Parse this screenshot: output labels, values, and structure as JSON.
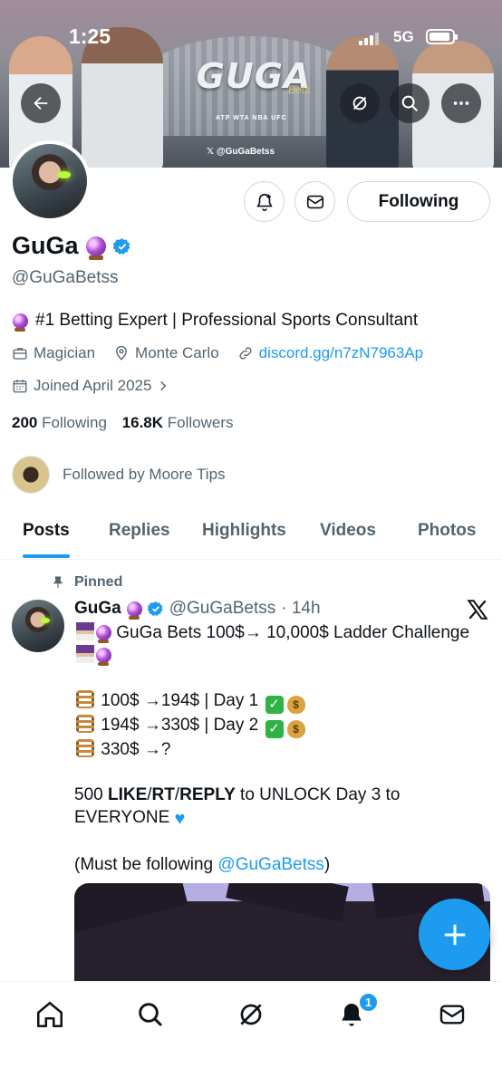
{
  "status_bar": {
    "time": "1:25",
    "network": "5G"
  },
  "banner": {
    "logo_text": "GUGA",
    "logo_sub": "Bets",
    "sponsors": "ATP WTA NBA UFC",
    "handle_text": "@GuGaBetss"
  },
  "profile": {
    "name": "GuGa",
    "handle": "@GuGaBetss",
    "bio": "#1 Betting Expert | Professional Sports Consultant",
    "category": "Magician",
    "location": "Monte Carlo",
    "link": "discord.gg/n7zN7963Ap",
    "joined": "Joined April 2025",
    "following_count": "200",
    "following_label": "Following",
    "followers_count": "16.8K",
    "followers_label": "Followers",
    "followed_by": "Followed by Moore Tips"
  },
  "actions": {
    "following_button": "Following"
  },
  "tabs": [
    {
      "label": "Posts",
      "active": true
    },
    {
      "label": "Replies"
    },
    {
      "label": "Highlights"
    },
    {
      "label": "Videos"
    },
    {
      "label": "Photos"
    }
  ],
  "pinned_post": {
    "pinned_label": "Pinned",
    "author_name": "GuGa",
    "author_handle": "@GuGaBetss",
    "time": "· 14h",
    "line1": "GuGa Bets 100$→ 10,000$ Ladder Challenge",
    "step1": "100$ →194$ | Day 1",
    "step2": "194$ →330$ | Day 2",
    "step3": "330$ →?",
    "cta_number": "500",
    "cta_like": "LIKE",
    "cta_rt": "RT",
    "cta_reply": "REPLY",
    "cta_rest": "to UNLOCK Day 3 to EVERYONE",
    "note_prefix": "(Must be following ",
    "note_mention": "@GuGaBetss",
    "note_suffix": ")"
  },
  "notifications_badge": "1",
  "colors": {
    "accent": "#1d9bf0",
    "text": "#0f1419",
    "muted": "#536471"
  }
}
